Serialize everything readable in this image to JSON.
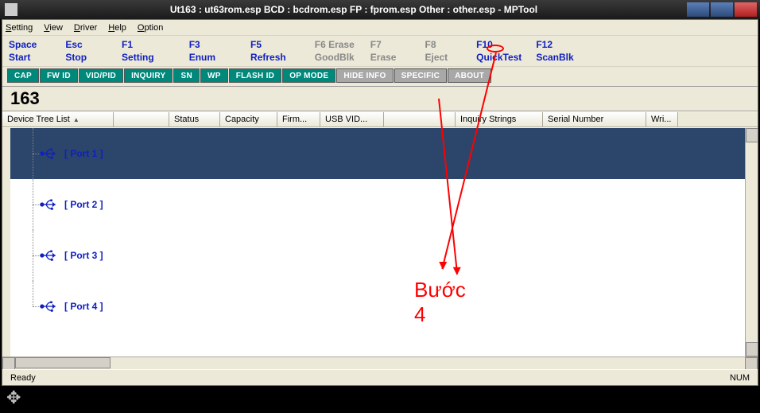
{
  "title": "Ut163 : ut63rom.esp BCD : bcdrom.esp FP : fprom.esp Other : other.esp - MPTool",
  "menu": {
    "setting": "Setting",
    "view": "View",
    "driver": "Driver",
    "help": "Help",
    "option": "Option"
  },
  "fkeys": [
    {
      "top": "Space",
      "bottom": "Start",
      "cls": ""
    },
    {
      "top": "Esc",
      "bottom": "Stop",
      "cls": ""
    },
    {
      "top": "F1",
      "bottom": "Setting",
      "cls": ""
    },
    {
      "top": "F3",
      "bottom": "Enum",
      "cls": ""
    },
    {
      "top": "F5",
      "bottom": "Refresh",
      "cls": ""
    },
    {
      "top": "F6 Erase",
      "bottom": "GoodBlk",
      "cls": "gray"
    },
    {
      "top": "F7",
      "bottom": "Erase",
      "cls": "gray"
    },
    {
      "top": "F8",
      "bottom": "Eject",
      "cls": "gray"
    },
    {
      "top": "F10",
      "bottom": "QuickTest",
      "cls": ""
    },
    {
      "top": "F12",
      "bottom": "ScanBlk",
      "cls": ""
    }
  ],
  "toolbar": [
    {
      "label": "CAP",
      "cls": "green"
    },
    {
      "label": "FW ID",
      "cls": "green"
    },
    {
      "label": "VID/PID",
      "cls": "green"
    },
    {
      "label": "INQUIRY",
      "cls": "green"
    },
    {
      "label": "SN",
      "cls": "green"
    },
    {
      "label": "WP",
      "cls": "green"
    },
    {
      "label": "FLASH ID",
      "cls": "green"
    },
    {
      "label": "OP MODE",
      "cls": "green"
    },
    {
      "label": "HIDE INFO",
      "cls": "gray"
    },
    {
      "label": "SPECIFIC",
      "cls": "gray"
    },
    {
      "label": "ABOUT",
      "cls": "gray"
    }
  ],
  "count": "163",
  "headers": [
    {
      "label": "Device Tree List",
      "w": 140,
      "sort": "▲"
    },
    {
      "label": "",
      "w": 70
    },
    {
      "label": "Status",
      "w": 64
    },
    {
      "label": "Capacity",
      "w": 72
    },
    {
      "label": "Firm...",
      "w": 54
    },
    {
      "label": "USB VID...",
      "w": 80
    },
    {
      "label": "",
      "w": 90
    },
    {
      "label": "Inquiry Strings",
      "w": 110
    },
    {
      "label": "Serial Number",
      "w": 130
    },
    {
      "label": "Wri...",
      "w": 40
    }
  ],
  "ports": [
    {
      "label": "[ Port  1 ]",
      "selected": true
    },
    {
      "label": "[ Port  2 ]",
      "selected": false
    },
    {
      "label": "[ Port  3 ]",
      "selected": false
    },
    {
      "label": "[ Port  4 ]",
      "selected": false
    }
  ],
  "status": {
    "ready": "Ready",
    "num": "NUM"
  },
  "annotation": {
    "text": "Bước 4"
  }
}
